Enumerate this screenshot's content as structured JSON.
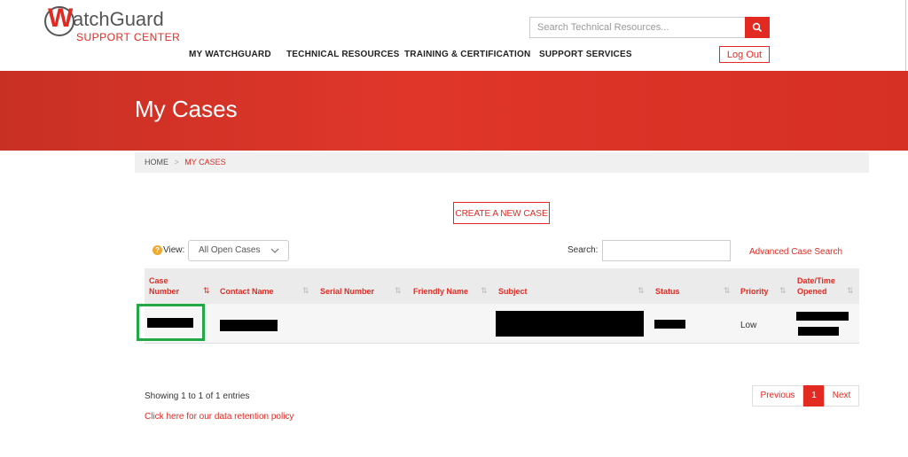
{
  "brand": {
    "name": "atchGuard",
    "initial": "W",
    "subtitle": "SUPPORT CENTER"
  },
  "header": {
    "search_placeholder": "Search Technical Resources...",
    "nav": [
      "MY WATCHGUARD",
      "TECHNICAL RESOURCES",
      "TRAINING & CERTIFICATION",
      "SUPPORT SERVICES"
    ],
    "logout_label": "Log Out"
  },
  "page": {
    "title": "My Cases"
  },
  "breadcrumb": {
    "home": "HOME",
    "separator": ">",
    "current": "MY CASES"
  },
  "actions": {
    "create_case": "CREATE A NEW CASE",
    "advanced_search": "Advanced Case Search"
  },
  "filters": {
    "view_label": "View:",
    "view_value": "All Open Cases",
    "search_label": "Search:"
  },
  "table": {
    "columns": [
      "Case Number",
      "Contact Name",
      "Serial Number",
      "Friendly Name",
      "Subject",
      "Status",
      "Priority",
      "Date/Time Opened"
    ],
    "rows": [
      {
        "priority": "Low"
      }
    ]
  },
  "footer": {
    "showing": "Showing 1 to 1 of 1 entries",
    "retention": "Click here for our data retention policy",
    "pager": {
      "previous": "Previous",
      "page": "1",
      "next": "Next"
    }
  },
  "colors": {
    "accent": "#e22a22",
    "highlight": "#22a845"
  }
}
